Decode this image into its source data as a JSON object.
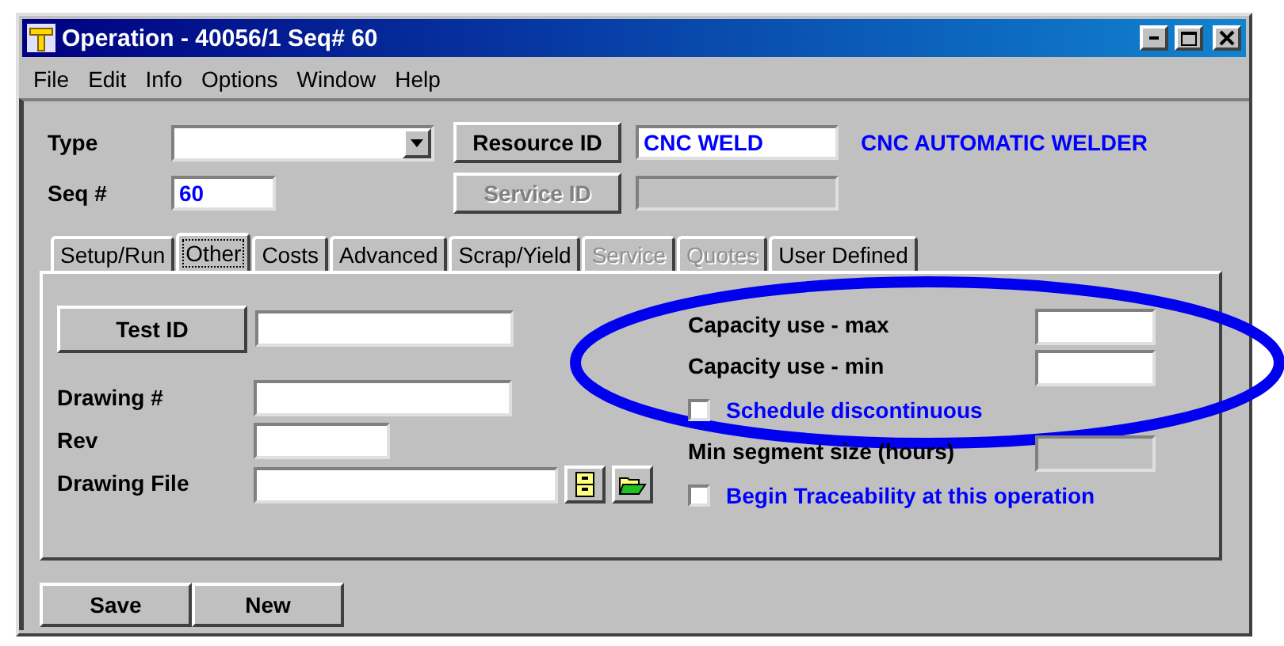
{
  "window": {
    "title": "Operation - 40056/1 Seq# 60"
  },
  "menu": [
    {
      "label": "File"
    },
    {
      "label": "Edit"
    },
    {
      "label": "Info"
    },
    {
      "label": "Options"
    },
    {
      "label": "Window"
    },
    {
      "label": "Help"
    }
  ],
  "header": {
    "type_label": "Type",
    "seq_label": "Seq #",
    "seq_value": "60",
    "resource_button": {
      "label": "Resource ID",
      "disabled": false
    },
    "resource_value": "CNC WELD",
    "resource_description": "CNC AUTOMATIC WELDER",
    "service_button": {
      "label": "Service ID",
      "disabled": true
    }
  },
  "tabs": [
    {
      "label": "Setup/Run",
      "selected": false,
      "disabled": false
    },
    {
      "label": "Other",
      "selected": true,
      "disabled": false
    },
    {
      "label": "Costs",
      "selected": false,
      "disabled": false
    },
    {
      "label": "Advanced",
      "selected": false,
      "disabled": false
    },
    {
      "label": "Scrap/Yield",
      "selected": false,
      "disabled": false
    },
    {
      "label": "Service",
      "selected": false,
      "disabled": true
    },
    {
      "label": "Quotes",
      "selected": false,
      "disabled": true
    },
    {
      "label": "User Defined",
      "selected": false,
      "disabled": false
    }
  ],
  "other_tab": {
    "test_button": {
      "label": "Test ID"
    },
    "left_fields": [
      {
        "label": "Drawing #",
        "kind": "text"
      },
      {
        "label": "Rev",
        "kind": "short"
      },
      {
        "label": "Drawing File",
        "kind": "file"
      }
    ],
    "right_rows": [
      {
        "kind": "field",
        "label": "Capacity use - max",
        "disabled": false
      },
      {
        "kind": "field",
        "label": "Capacity use - min",
        "disabled": false
      },
      {
        "kind": "checkbox",
        "label": "Schedule discontinuous",
        "checked": false
      },
      {
        "kind": "field",
        "label": "Min segment size (hours)",
        "disabled": true
      },
      {
        "kind": "checkbox",
        "label": "Begin Traceability at this operation",
        "checked": false
      }
    ]
  },
  "buttons": [
    {
      "label": "Save"
    },
    {
      "label": "New"
    }
  ]
}
